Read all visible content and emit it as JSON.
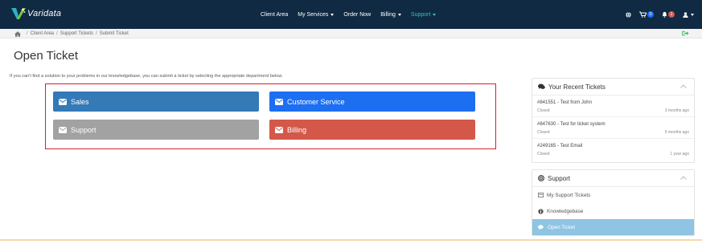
{
  "brand": {
    "name": "Varidata"
  },
  "nav": {
    "links": [
      {
        "label": "Client Area"
      },
      {
        "label": "My Services"
      },
      {
        "label": "Order Now"
      },
      {
        "label": "Billing"
      },
      {
        "label": "Support"
      }
    ],
    "cart_count": "0",
    "notification_count": "1"
  },
  "breadcrumb": [
    "Client Area",
    "Support Tickets",
    "Submit Ticket"
  ],
  "page": {
    "title": "Open Ticket",
    "intro": "If you can't find a solution to your problems in our knowledgebase, you can submit a ticket by selecting the appropriate department below."
  },
  "departments": [
    {
      "label": "Sales",
      "color": "#337ab7"
    },
    {
      "label": "Customer Service",
      "color": "#1d6ff2"
    },
    {
      "label": "Support",
      "color": "#a2a2a2"
    },
    {
      "label": "Billing",
      "color": "#d3584a"
    }
  ],
  "recent_tickets": {
    "title": "Your Recent Tickets",
    "items": [
      {
        "title": "#841551 - Test from John",
        "status": "Closed",
        "time": "3 months ago"
      },
      {
        "title": "#847630 - Test for ticket system",
        "status": "Closed",
        "time": "6 months ago"
      },
      {
        "title": "#249165 - Test Email",
        "status": "Closed",
        "time": "1 year ago"
      }
    ]
  },
  "support_panel": {
    "title": "Support",
    "items": [
      {
        "label": "My Support Tickets"
      },
      {
        "label": "Knowledgebase"
      },
      {
        "label": "Open Ticket"
      }
    ]
  },
  "colors": {
    "navbar": "#102a43",
    "accent": "#35c0c0",
    "highlight": "#d6202f"
  }
}
